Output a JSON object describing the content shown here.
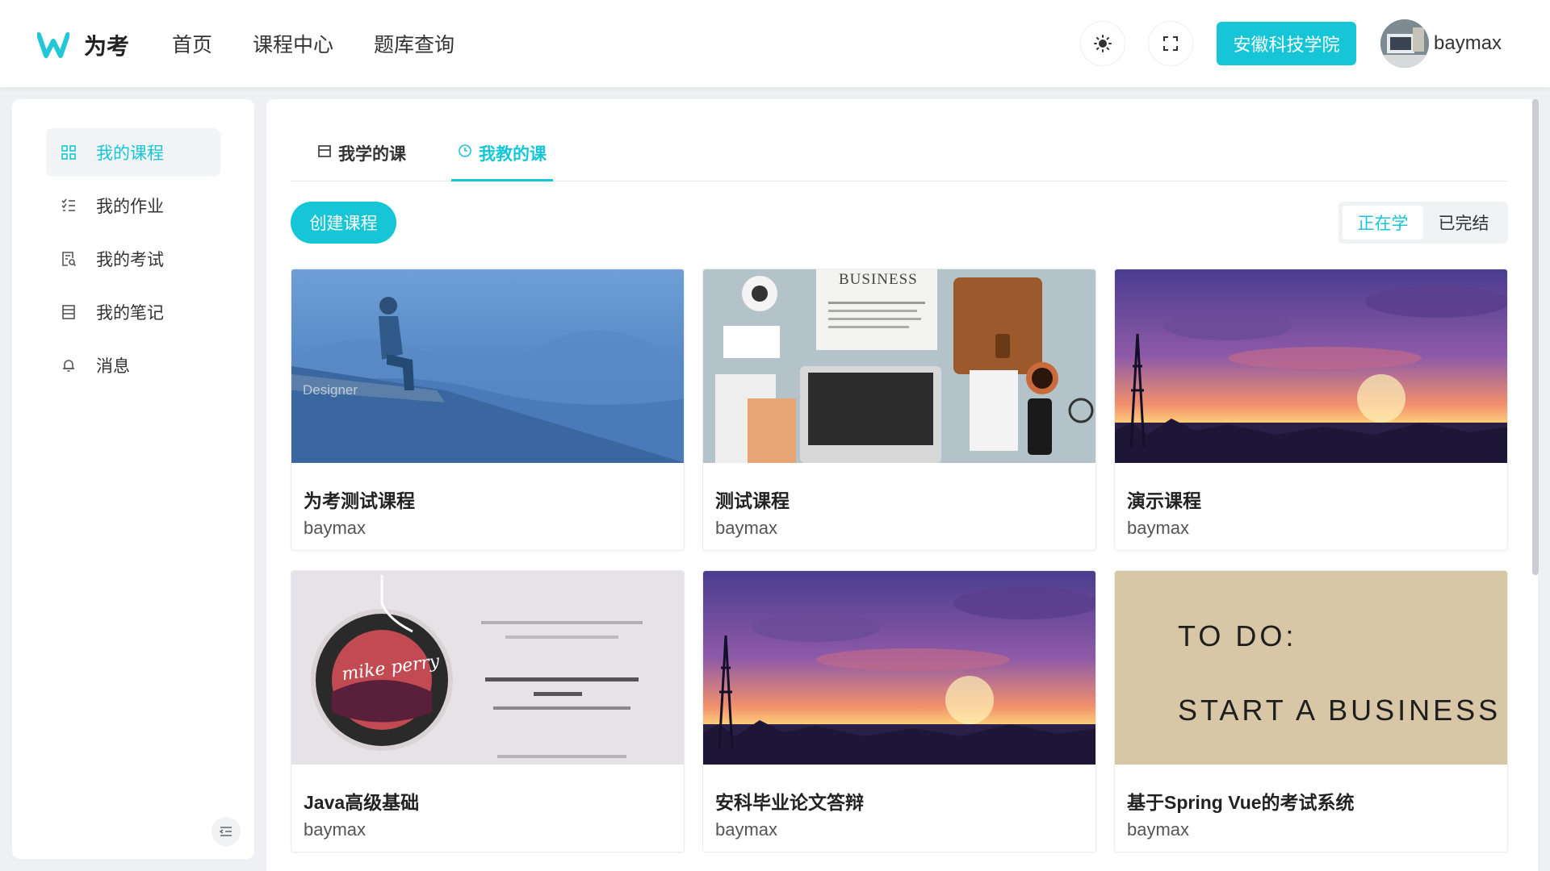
{
  "app": {
    "name": "为考"
  },
  "nav": {
    "items": [
      "首页",
      "课程中心",
      "题库查询"
    ]
  },
  "header": {
    "org_button": "安徽科技学院",
    "username": "baymax"
  },
  "sidebar": {
    "items": [
      {
        "label": "我的课程",
        "icon": "grid-icon",
        "active": true
      },
      {
        "label": "我的作业",
        "icon": "checklist-icon"
      },
      {
        "label": "我的考试",
        "icon": "exam-icon"
      },
      {
        "label": "我的笔记",
        "icon": "notes-icon"
      },
      {
        "label": "消息",
        "icon": "bell-icon"
      }
    ]
  },
  "tabs": [
    {
      "label": "我学的课",
      "icon": "calendar-icon"
    },
    {
      "label": "我教的课",
      "icon": "clock-icon",
      "active": true
    }
  ],
  "actions": {
    "create": "创建课程"
  },
  "filter": {
    "options": [
      "正在学",
      "已完结"
    ],
    "selected": "正在学"
  },
  "cards": [
    {
      "title": "为考测试课程",
      "author": "baymax",
      "image_text": "Designer"
    },
    {
      "title": "测试课程",
      "author": "baymax",
      "image_text": "BUSINESS"
    },
    {
      "title": "演示课程",
      "author": "baymax"
    },
    {
      "title": "Java高级基础",
      "author": "baymax",
      "image_text": "mike perry"
    },
    {
      "title": "安科毕业论文答辩",
      "author": "baymax"
    },
    {
      "title": "基于Spring Vue的考试系统",
      "author": "baymax",
      "image_line1": "TO DO:",
      "image_line2": "START A BUSINESS"
    }
  ],
  "colors": {
    "accent": "#16c6d6"
  }
}
